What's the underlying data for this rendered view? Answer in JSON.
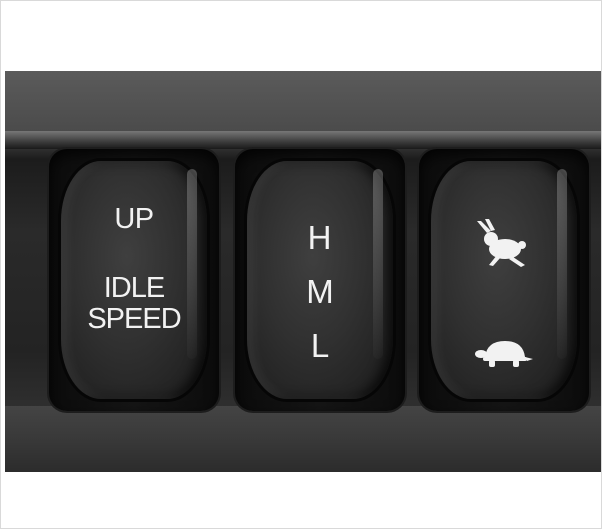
{
  "image": {
    "description_free": true
  },
  "switches": [
    {
      "name": "idle-speed-switch",
      "top_label": "UP",
      "bottom_label_line1": "IDLE",
      "bottom_label_line2": "SPEED"
    },
    {
      "name": "hml-switch",
      "letters": [
        "H",
        "M",
        "L"
      ]
    },
    {
      "name": "speed-mode-switch",
      "top_icon": "rabbit-icon",
      "bottom_icon": "turtle-icon"
    }
  ],
  "colors": {
    "label": "#f2f2f2",
    "rocker": "#303030",
    "panel": "#2a2a2a"
  }
}
